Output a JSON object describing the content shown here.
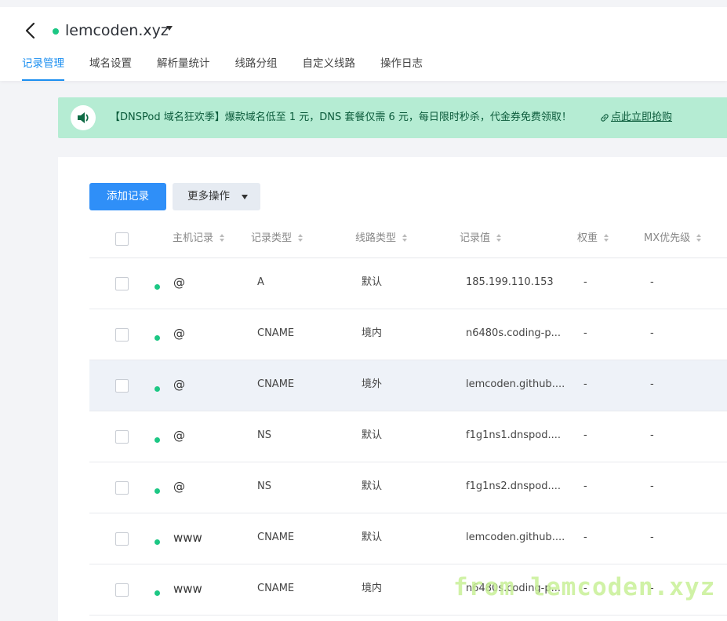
{
  "header": {
    "domain": "lemcoden.xyz",
    "status_color": "#1cc784",
    "tabs": [
      {
        "label": "记录管理",
        "active": true
      },
      {
        "label": "域名设置"
      },
      {
        "label": "解析量统计"
      },
      {
        "label": "线路分组"
      },
      {
        "label": "自定义线路"
      },
      {
        "label": "操作日志"
      }
    ]
  },
  "banner": {
    "icon": "speaker-icon",
    "text": "【DNSPod 域名狂欢季】爆款域名低至 1 元，DNS 套餐仅需 6 元，每日限时秒杀，代金券免费领取！",
    "link_text": "点此立即抢购",
    "bg_color": "#b5ecd3"
  },
  "toolbar": {
    "add_label": "添加记录",
    "more_label": "更多操作",
    "accent_color": "#2f8ff8"
  },
  "table": {
    "columns": [
      "主机记录",
      "记录类型",
      "线路类型",
      "记录值",
      "权重",
      "MX优先级"
    ],
    "rows": [
      {
        "host": "@",
        "type": "A",
        "line": "默认",
        "value": "185.199.110.153",
        "weight": "-",
        "mx": "-"
      },
      {
        "host": "@",
        "type": "CNAME",
        "line": "境内",
        "value": "n6480s.coding-p...",
        "weight": "-",
        "mx": "-"
      },
      {
        "host": "@",
        "type": "CNAME",
        "line": "境外",
        "value": "lemcoden.github....",
        "weight": "-",
        "mx": "-"
      },
      {
        "host": "@",
        "type": "NS",
        "line": "默认",
        "value": "f1g1ns1.dnspod....",
        "weight": "-",
        "mx": "-"
      },
      {
        "host": "@",
        "type": "NS",
        "line": "默认",
        "value": "f1g1ns2.dnspod....",
        "weight": "-",
        "mx": "-"
      },
      {
        "host": "www",
        "type": "CNAME",
        "line": "默认",
        "value": "lemcoden.github....",
        "weight": "-",
        "mx": "-"
      },
      {
        "host": "www",
        "type": "CNAME",
        "line": "境内",
        "value": "n6480s.coding-p...",
        "weight": "-",
        "mx": "-"
      }
    ]
  },
  "watermark": "from lemcoden.xyz"
}
